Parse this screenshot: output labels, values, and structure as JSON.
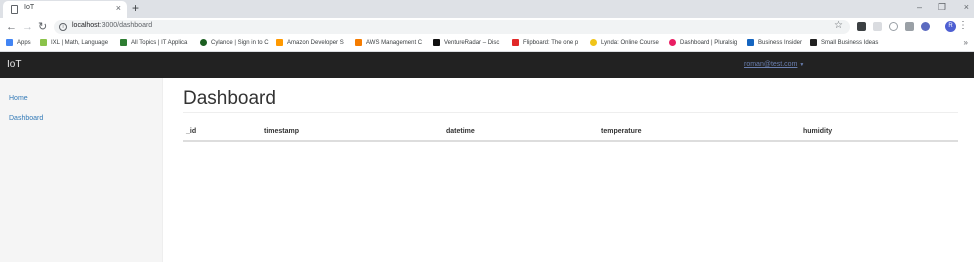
{
  "browser": {
    "tab_title": "IoT",
    "new_tab": "+",
    "close_glyph": "×",
    "url_host": "localhost",
    "url_path": ":3000/dashboard",
    "profile_initial": "R",
    "bookmarks": [
      {
        "label": "Apps",
        "icon": "apps-grid-icon",
        "color": "#4285f4"
      },
      {
        "label": "IXL | Math, Language",
        "icon": "ixl-icon",
        "color": "#8bc34a"
      },
      {
        "label": "All Topics | IT Applica",
        "icon": "topics-icon",
        "color": "#2e7d32"
      },
      {
        "label": "Cylance | Sign in to C",
        "icon": "cylance-icon",
        "color": "#1b5e20"
      },
      {
        "label": "Amazon Developer S",
        "icon": "amazon-icon",
        "color": "#ff9900"
      },
      {
        "label": "AWS Management C",
        "icon": "aws-icon",
        "color": "#f57c00"
      },
      {
        "label": "VentureRadar – Disc",
        "icon": "ventureradar-icon",
        "color": "#111111"
      },
      {
        "label": "Flipboard: The one p",
        "icon": "flipboard-icon",
        "color": "#e12828"
      },
      {
        "label": "Lynda: Online Course",
        "icon": "lynda-icon",
        "color": "#f0c419"
      },
      {
        "label": "Dashboard | Pluralsig",
        "icon": "pluralsight-icon",
        "color": "#e91e63"
      },
      {
        "label": "Business Insider",
        "icon": "business-insider-icon",
        "color": "#1565c0"
      },
      {
        "label": "Small Business Ideas",
        "icon": "small-business-icon",
        "color": "#212121"
      }
    ]
  },
  "app": {
    "brand": "IoT",
    "user_email": "roman@test.com",
    "sidebar": [
      {
        "label": "Home"
      },
      {
        "label": "Dashboard"
      }
    ],
    "page_title": "Dashboard",
    "table": {
      "columns": [
        "_id",
        "timestamp",
        "datetime",
        "temperature",
        "humidity"
      ],
      "rows": []
    }
  }
}
